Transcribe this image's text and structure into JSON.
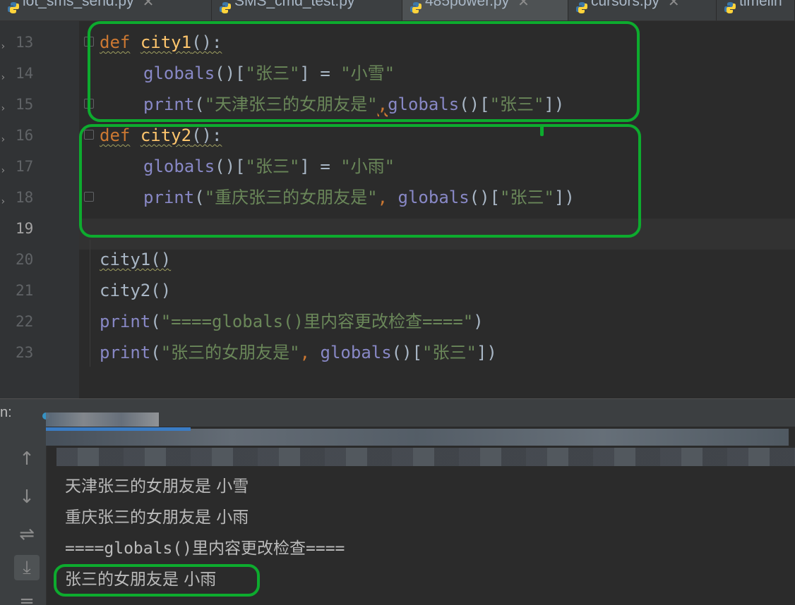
{
  "tabs": [
    {
      "label": "iot_sms_send.py",
      "active": false,
      "icon": "python-icon"
    },
    {
      "label": "SMS_cmd_test.py",
      "active": false,
      "icon": "python-icon"
    },
    {
      "label": "485power.py",
      "active": true,
      "icon": "python-icon"
    },
    {
      "label": "cursors.py",
      "active": false,
      "icon": "python-icon"
    },
    {
      "label": "timelin",
      "active": false,
      "icon": "python-icon"
    }
  ],
  "editor": {
    "line_numbers": [
      "13",
      "14",
      "15",
      "16",
      "17",
      "18",
      "19",
      "20",
      "21",
      "22",
      "23"
    ],
    "current_line": "19",
    "code": {
      "l13_kw": "def",
      "l13_fn": "city1",
      "l13_rest": "():",
      "l14_bi": "globals",
      "l14_a": "()[",
      "l14_key": "\"张三\"",
      "l14_b": "] = ",
      "l14_val": "\"小雪\"",
      "l15_bi": "print",
      "l15_a": "(",
      "l15_str": "\"天津张三的女朋友是\"",
      "l15_comma": ",",
      "l15_bi2": "globals",
      "l15_b": "()[",
      "l15_key": "\"张三\"",
      "l15_c": "])",
      "l16_kw": "def",
      "l16_fn": "city2",
      "l16_rest": "():",
      "l17_bi": "globals",
      "l17_a": "()[",
      "l17_key": "\"张三\"",
      "l17_b": "] = ",
      "l17_val": "\"小雨\"",
      "l18_bi": "print",
      "l18_a": "(",
      "l18_str": "\"重庆张三的女朋友是\"",
      "l18_comma": ", ",
      "l18_bi2": "globals",
      "l18_b": "()[",
      "l18_key": "\"张三\"",
      "l18_c": "])",
      "l20": "city1()",
      "l21": "city2()",
      "l22_bi": "print",
      "l22_a": "(",
      "l22_str": "\"====globals()里内容更改检查====\"",
      "l22_b": ")",
      "l23_bi": "print",
      "l23_a": "(",
      "l23_str": "\"张三的女朋友是\"",
      "l23_comma": ", ",
      "l23_bi2": "globals",
      "l23_b": "()[",
      "l23_key": "\"张三\"",
      "l23_c": "])"
    }
  },
  "run_panel": {
    "label": "n:",
    "output": [
      "天津张三的女朋友是 小雪",
      "重庆张三的女朋友是 小雨",
      "====globals()里内容更改检查====",
      "张三的女朋友是 小雨"
    ],
    "tools": [
      "arrow-up-icon",
      "arrow-down-icon",
      "soft-wrap-icon",
      "scroll-to-end-icon",
      "print-icon"
    ]
  },
  "colors": {
    "highlight": "#0dab2e",
    "keyword": "#cc7832",
    "function": "#ffc66d",
    "builtin": "#8888c6",
    "string": "#6a8759",
    "text": "#a9b7c6"
  }
}
